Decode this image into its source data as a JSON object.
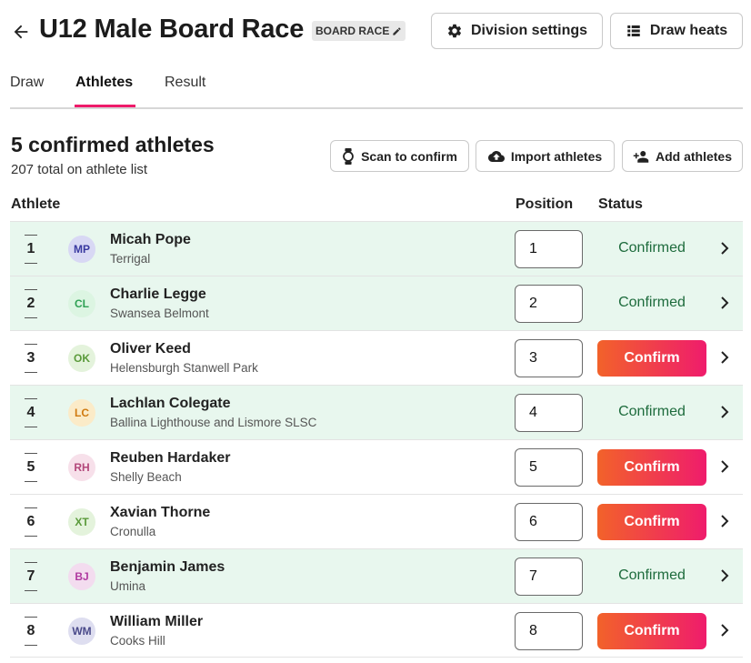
{
  "header": {
    "title": "U12 Male Board Race",
    "badge": "BOARD RACE",
    "division_settings_label": "Division settings",
    "draw_heats_label": "Draw heats"
  },
  "tabs": [
    {
      "label": "Draw",
      "active": false
    },
    {
      "label": "Athletes",
      "active": true
    },
    {
      "label": "Result",
      "active": false
    }
  ],
  "summary": {
    "title": "5 confirmed athletes",
    "subtitle": "207 total on athlete list"
  },
  "actions": {
    "scan_label": "Scan to confirm",
    "import_label": "Import athletes",
    "add_label": "Add athletes"
  },
  "columns": {
    "athlete": "Athlete",
    "position": "Position",
    "status": "Status"
  },
  "confirm_label": "Confirm",
  "athletes": [
    {
      "rank": "1",
      "initials": "MP",
      "name": "Micah Pope",
      "club": "Terrigal",
      "position": "1",
      "confirmed": true,
      "status": "Confirmed",
      "avatar_bg": "#d8d8f4",
      "avatar_fg": "#3a3aa0"
    },
    {
      "rank": "2",
      "initials": "CL",
      "name": "Charlie Legge",
      "club": "Swansea Belmont",
      "position": "2",
      "confirmed": true,
      "status": "Confirmed",
      "avatar_bg": "#dcf5e2",
      "avatar_fg": "#2fa154"
    },
    {
      "rank": "3",
      "initials": "OK",
      "name": "Oliver Keed",
      "club": "Helensburgh Stanwell Park",
      "position": "3",
      "confirmed": false,
      "status": "",
      "avatar_bg": "#e4f3dc",
      "avatar_fg": "#5a9a3a"
    },
    {
      "rank": "4",
      "initials": "LC",
      "name": "Lachlan Colegate",
      "club": "Ballina Lighthouse and Lismore SLSC",
      "position": "4",
      "confirmed": true,
      "status": "Confirmed",
      "avatar_bg": "#fbebc8",
      "avatar_fg": "#d07a10"
    },
    {
      "rank": "5",
      "initials": "RH",
      "name": "Reuben Hardaker",
      "club": "Shelly Beach",
      "position": "5",
      "confirmed": false,
      "status": "",
      "avatar_bg": "#f7e0ea",
      "avatar_fg": "#b3477a"
    },
    {
      "rank": "6",
      "initials": "XT",
      "name": "Xavian Thorne",
      "club": "Cronulla",
      "position": "6",
      "confirmed": false,
      "status": "",
      "avatar_bg": "#e4f3dc",
      "avatar_fg": "#5a9a3a"
    },
    {
      "rank": "7",
      "initials": "BJ",
      "name": "Benjamin James",
      "club": "Umina",
      "position": "7",
      "confirmed": true,
      "status": "Confirmed",
      "avatar_bg": "#f3dcef",
      "avatar_fg": "#b03aa0"
    },
    {
      "rank": "8",
      "initials": "WM",
      "name": "William Miller",
      "club": "Cooks Hill",
      "position": "8",
      "confirmed": false,
      "status": "",
      "avatar_bg": "#dedef0",
      "avatar_fg": "#4a4a8a"
    }
  ]
}
